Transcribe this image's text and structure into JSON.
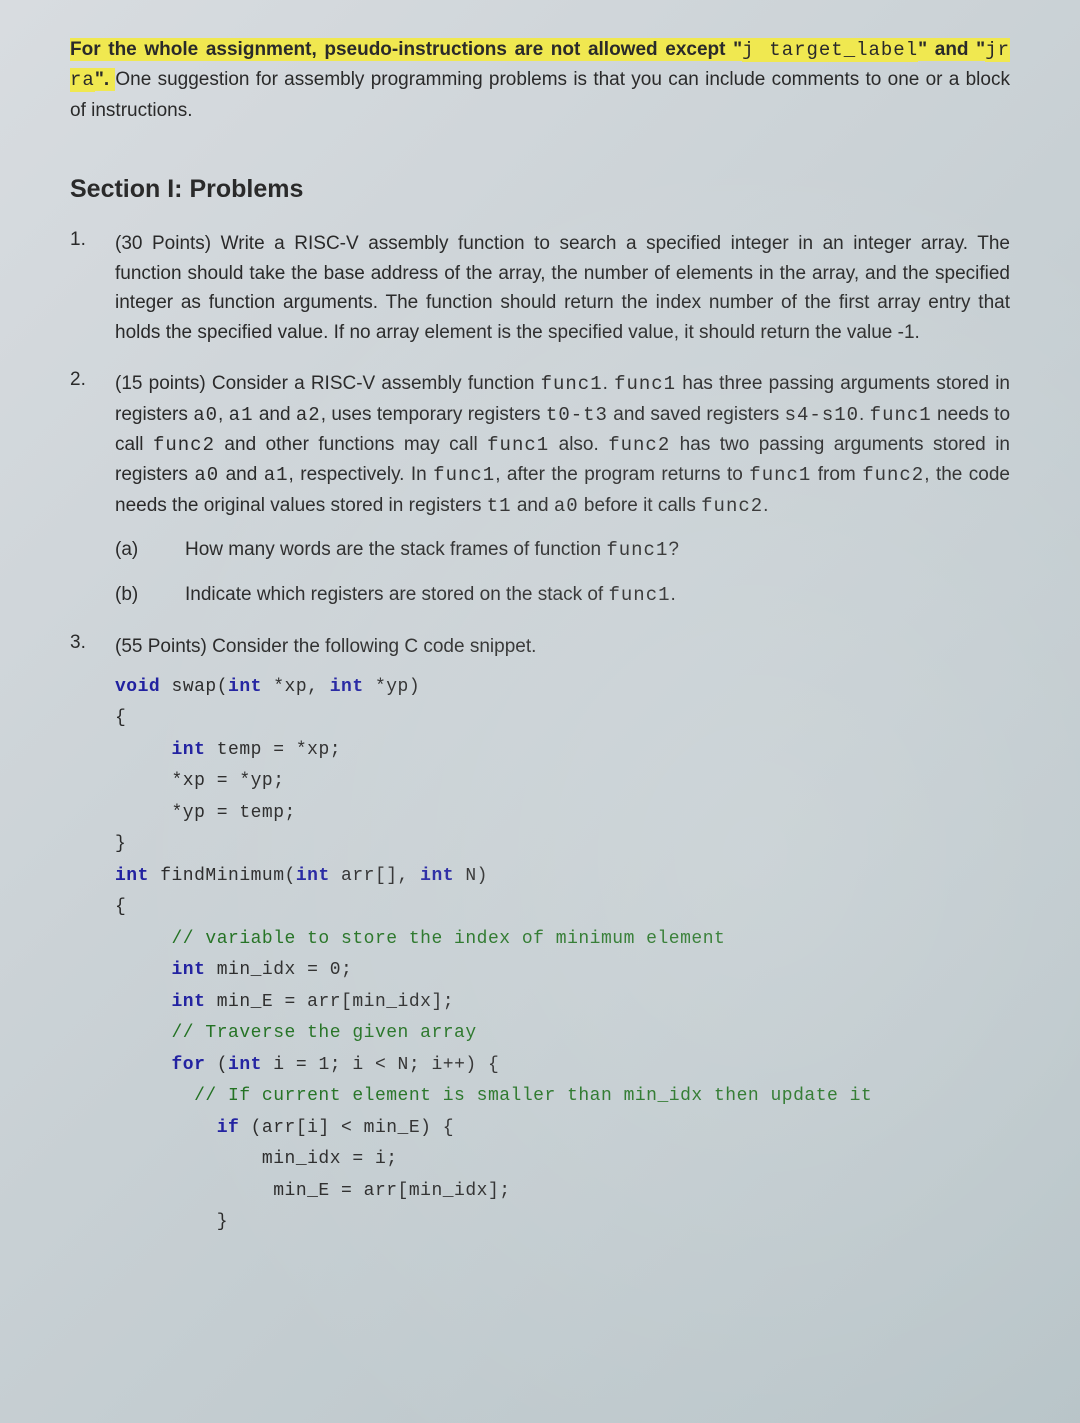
{
  "intro": {
    "highlightedPart1": "For the whole assignment, pseudo-instructions are not allowed except \"",
    "highlightedCode1": "j target_label",
    "highlightedPart2": "\" and \"",
    "highlightedCode2": "jr ra",
    "highlightedPart3": "\". ",
    "rest": "One suggestion for assembly programming problems is that you can include comments to one or a block of instructions."
  },
  "sectionTitle": "Section I: Problems",
  "problems": {
    "p1": {
      "num": "1.",
      "textA": "(30 Points) Write a RISC-V assembly function to search a specified integer in an integer array. The function should take the base address of the array, the number of elements in the array, and the specified integer as function arguments. The function should return the index number of the first array entry that holds the specified value. If no array element is the specified value, it should return the value -1."
    },
    "p2": {
      "num": "2.",
      "t1": "(15 points) Consider a RISC-V assembly function ",
      "c1": "func1",
      "t2": ". ",
      "c2": "func1",
      "t3": " has three passing arguments stored in registers ",
      "c3": "a0",
      "t4": ", ",
      "c4": "a1",
      "t5": " and ",
      "c5": "a2",
      "t6": ", uses temporary registers ",
      "c6": "t0-t3",
      "t7": " and saved registers ",
      "c7": "s4-s10",
      "t8": ". ",
      "c8": "func1",
      "t9": " needs to call ",
      "c9": "func2",
      "t10": " and other functions may call ",
      "c10": "func1",
      "t11": " also. ",
      "c11": "func2",
      "t12": " has two passing arguments stored in registers ",
      "c12": "a0",
      "t13": " and ",
      "c13": "a1",
      "t14": ", respectively. In ",
      "c14": "func1",
      "t15": ", after the program returns to ",
      "c15": "func1",
      "t16": " from ",
      "c16": "func2",
      "t17": ", the code needs the original values stored in registers ",
      "c17": "t1",
      "t18": " and ",
      "c18": "a0",
      "t19": " before it calls ",
      "c19": "func2",
      "t20": ".",
      "subA": {
        "label": "(a)",
        "textA": "How many words are the stack frames of function ",
        "codeA": "func1",
        "textB": "?"
      },
      "subB": {
        "label": "(b)",
        "textA": "Indicate which registers are stored on the stack of ",
        "codeA": "func1",
        "textB": "."
      }
    },
    "p3": {
      "num": "3.",
      "text": "(55 Points) Consider the following C code snippet."
    }
  },
  "code": {
    "l1a": "void",
    "l1b": " swap(",
    "l1c": "int",
    "l1d": " *xp, ",
    "l1e": "int",
    "l1f": " *yp)",
    "l2": "{",
    "l3a": "     int",
    "l3b": " temp = *xp;",
    "l4": "     *xp = *yp;",
    "l5": "     *yp = temp;",
    "l6": "}",
    "l7a": "int",
    "l7b": " findMinimum(",
    "l7c": "int",
    "l7d": " arr[], ",
    "l7e": "int",
    "l7f": " N)",
    "l8": "{",
    "l9": "     // variable to store the index of minimum element",
    "l10a": "     int",
    "l10b": " min_idx = 0;",
    "l11a": "     int",
    "l11b": " min_E = arr[min_idx];",
    "l12": "     // Traverse the given array",
    "l13a": "     for",
    "l13b": " (",
    "l13c": "int",
    "l13d": " i = 1; i < N; i++) {",
    "l14": "       // If current element is smaller than min_idx then update it",
    "l15a": "         if",
    "l15b": " (arr[i] < min_E) {",
    "l16": "             min_idx = i;",
    "l17": "              min_E = arr[min_idx];",
    "l18": "         }"
  }
}
